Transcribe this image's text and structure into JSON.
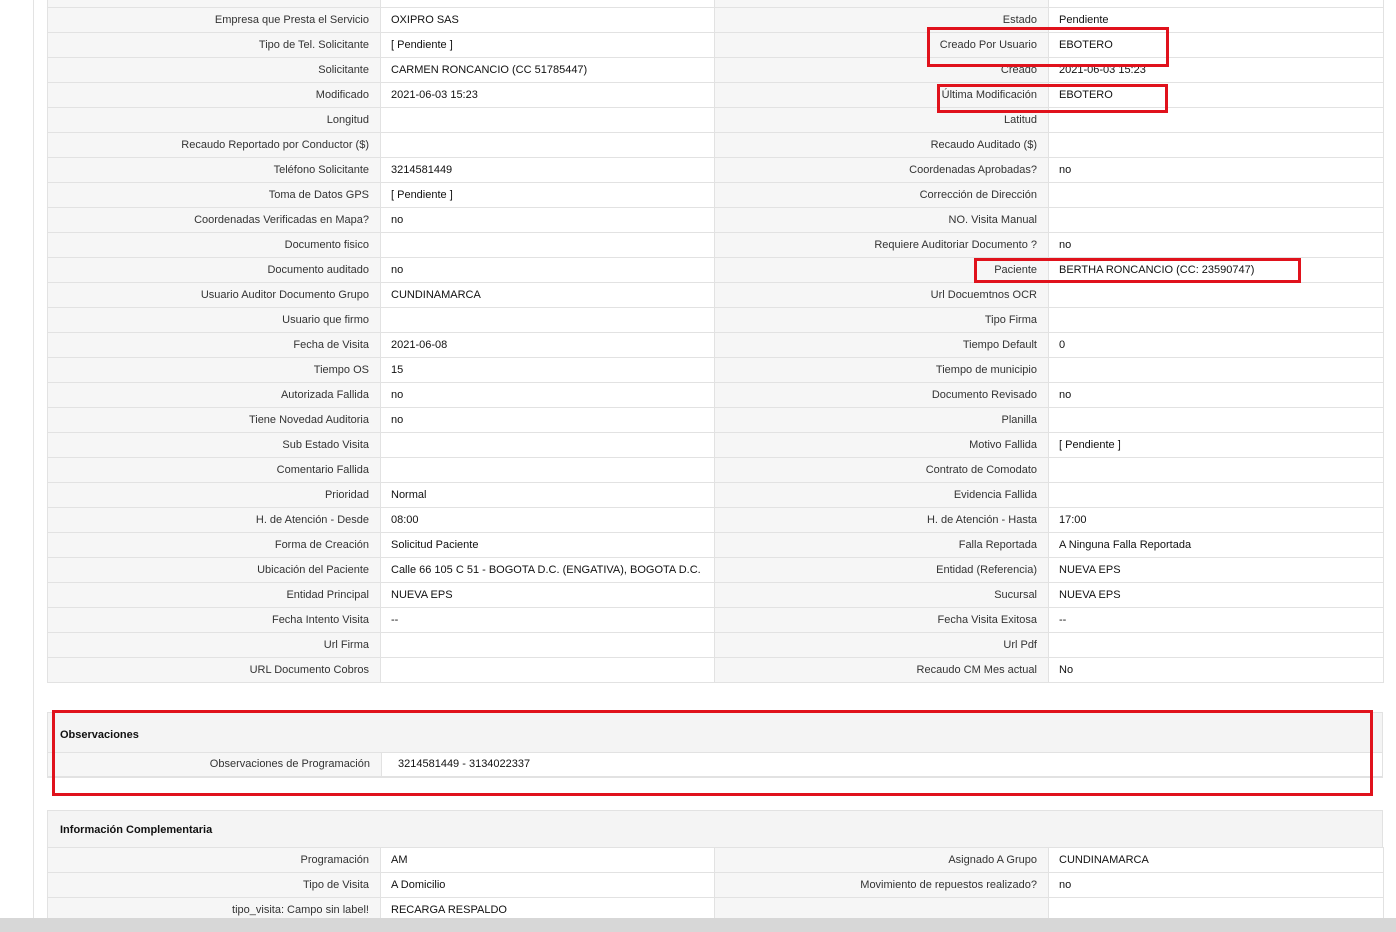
{
  "main_rows": [
    {
      "l1": "",
      "v1": "",
      "l2": "",
      "v2": ""
    },
    {
      "l1": "Empresa que Presta el Servicio",
      "v1": "OXIPRO SAS",
      "l2": "Estado",
      "v2": "Pendiente"
    },
    {
      "l1": "Tipo de Tel. Solicitante",
      "v1": "[ Pendiente ]",
      "l2": "Creado Por Usuario",
      "v2": "EBOTERO"
    },
    {
      "l1": "Solicitante",
      "v1": "CARMEN RONCANCIO (CC 51785447)",
      "l2": "Creado",
      "v2": "2021-06-03 15:23"
    },
    {
      "l1": "Modificado",
      "v1": "2021-06-03 15:23",
      "l2": "Última Modificación",
      "v2": " EBOTERO"
    },
    {
      "l1": "Longitud",
      "v1": "",
      "l2": "Latitud",
      "v2": ""
    },
    {
      "l1": "Recaudo Reportado por Conductor ($)",
      "v1": "",
      "l2": "Recaudo Auditado ($)",
      "v2": ""
    },
    {
      "l1": "Teléfono Solicitante",
      "v1": "3214581449",
      "l2": "Coordenadas Aprobadas?",
      "v2": " no"
    },
    {
      "l1": "Toma de Datos GPS",
      "v1": "[ Pendiente ]",
      "l2": "Corrección de Dirección",
      "v2": ""
    },
    {
      "l1": "Coordenadas Verificadas en Mapa?",
      "v1": " no",
      "l2": "NO. Visita Manual",
      "v2": ""
    },
    {
      "l1": "Documento fisico",
      "v1": "",
      "l2": "Requiere Auditoriar Documento ?",
      "v2": " no"
    },
    {
      "l1": "Documento auditado",
      "v1": " no",
      "l2": "Paciente",
      "v2": "BERTHA RONCANCIO (CC: 23590747)"
    },
    {
      "l1": "Usuario Auditor Documento Grupo",
      "v1": "CUNDINAMARCA",
      "l2": "Url Docuemtnos OCR",
      "v2": ""
    },
    {
      "l1": "Usuario que firmo",
      "v1": "",
      "l2": "Tipo Firma",
      "v2": ""
    },
    {
      "l1": "Fecha de Visita",
      "v1": " 2021-06-08",
      "l2": "Tiempo Default",
      "v2": "0"
    },
    {
      "l1": "Tiempo OS",
      "v1": "15",
      "l2": "Tiempo de municipio",
      "v2": ""
    },
    {
      "l1": "Autorizada Fallida",
      "v1": " no",
      "l2": "Documento Revisado",
      "v2": " no"
    },
    {
      "l1": "Tiene Novedad Auditoria",
      "v1": " no",
      "l2": "Planilla",
      "v2": ""
    },
    {
      "l1": "Sub Estado Visita",
      "v1": "",
      "l2": "Motivo Fallida",
      "v2": "[ Pendiente ]"
    },
    {
      "l1": "Comentario Fallida",
      "v1": "",
      "l2": "Contrato de Comodato",
      "v2": ""
    },
    {
      "l1": "Prioridad",
      "v1": "Normal",
      "l2": "Evidencia Fallida",
      "v2": ""
    },
    {
      "l1": "H. de Atención - Desde",
      "v1": "08:00",
      "l2": "H. de Atención - Hasta",
      "v2": "17:00"
    },
    {
      "l1": "Forma de Creación",
      "v1": "Solicitud Paciente",
      "l2": "Falla Reportada",
      "v2": "A Ninguna Falla Reportada"
    },
    {
      "l1": "Ubicación del Paciente",
      "v1": "Calle 66 105 C 51 - BOGOTA D.C. (ENGATIVA), BOGOTA D.C.",
      "l2": "Entidad (Referencia)",
      "v2": "NUEVA EPS"
    },
    {
      "l1": "Entidad Principal",
      "v1": "NUEVA EPS",
      "l2": "Sucursal",
      "v2": "NUEVA EPS"
    },
    {
      "l1": "Fecha Intento Visita",
      "v1": " --",
      "l2": "Fecha Visita Exitosa",
      "v2": " --"
    },
    {
      "l1": "Url Firma",
      "v1": "",
      "l2": "Url Pdf",
      "v2": ""
    },
    {
      "l1": "URL Documento Cobros",
      "v1": "",
      "l2": "Recaudo CM Mes actual",
      "v2": "No"
    }
  ],
  "observaciones": {
    "title": "Observaciones",
    "label": "Observaciones de Programación",
    "value": "3214581449 - 3134022337"
  },
  "info": {
    "title": "Información Complementaria",
    "rows": [
      {
        "l1": "Programación",
        "v1": "AM",
        "l2": "Asignado A Grupo",
        "v2": "CUNDINAMARCA"
      },
      {
        "l1": "Tipo de Visita",
        "v1": "A Domicilio",
        "l2": "Movimiento de repuestos realizado?",
        "v2": " no"
      },
      {
        "l1": "tipo_visita: Campo sin label!",
        "v1": "RECARGA RESPALDO",
        "l2": "",
        "v2": ""
      }
    ]
  },
  "colors": {
    "highlight": "#e0121c",
    "border": "#e2e2e2",
    "label_bg": "#f6f6f6"
  }
}
